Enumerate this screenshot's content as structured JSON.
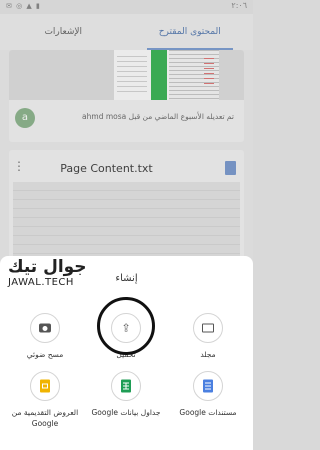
{
  "status_bar": {
    "time": "٢:٠٦",
    "icons": "✉ ◎ ▲ ▮"
  },
  "tabs": {
    "suggested": "المحتوى المقترح",
    "notifications": "الإشعارات"
  },
  "activity": {
    "avatar_letter": "a",
    "text": "تم تعديله الأسبوع الماضي من قبل ahmd mosa"
  },
  "file_card": {
    "title": "Page Content.txt",
    "more_icon": "more-vertical-icon",
    "file_icon": "doc-file-icon"
  },
  "sheet": {
    "title": "إنشاء",
    "options_row1": [
      {
        "label": "مجلد",
        "icon": "folder-icon"
      },
      {
        "label": "تحميل",
        "icon": "upload-icon"
      },
      {
        "label": "مسح ضوئي",
        "icon": "camera-icon"
      }
    ],
    "options_row2": [
      {
        "label": "مستندات Google",
        "icon": "google-docs-icon"
      },
      {
        "label": "جداول بيانات Google",
        "icon": "google-sheets-icon"
      },
      {
        "label": "العروض التقديمية من Google",
        "icon": "google-slides-icon"
      }
    ]
  },
  "watermark": {
    "arabic": "جوال تيك",
    "latin": "JAWAL.TECH"
  },
  "colors": {
    "accent": "#5c7fb3",
    "docs": "#4a7fe0",
    "sheets": "#1f9d55",
    "slides": "#f0b400"
  }
}
